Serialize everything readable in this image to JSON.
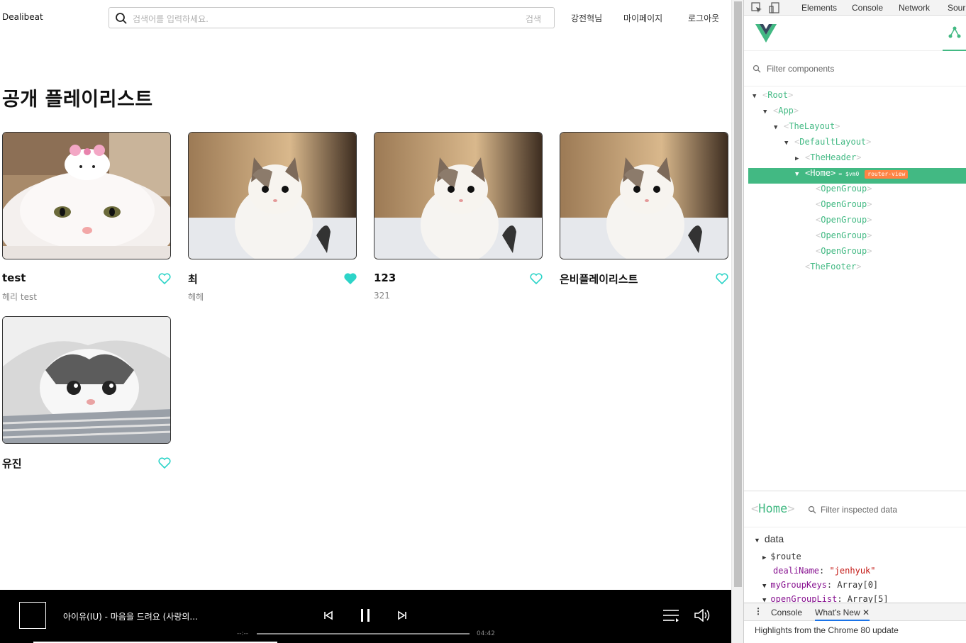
{
  "header": {
    "logo": "Dealibeat",
    "search_placeholder": "검색어를 입력하세요.",
    "search_button": "검색",
    "nav": [
      "강전혁님",
      "마이페이지",
      "로그아웃"
    ]
  },
  "page_title": "공개 플레이리스트",
  "playlists": [
    {
      "title": "test",
      "subtitle": "헤리 test",
      "liked": false,
      "image": "cat-with-hello-kitty-hat"
    },
    {
      "title": "최",
      "subtitle": "헤헤",
      "liked": true,
      "image": "calico-kitten"
    },
    {
      "title": "123",
      "subtitle": "321",
      "liked": false,
      "image": "calico-kitten"
    },
    {
      "title": "은비플레이리스트",
      "subtitle": "",
      "liked": false,
      "image": "calico-kitten"
    },
    {
      "title": "유진",
      "subtitle": "",
      "liked": false,
      "image": "kitten-in-blanket"
    }
  ],
  "player": {
    "track": "아이유(IU) - 마음을 드려요 (사랑의...",
    "elapsed": "--:--",
    "duration": "04:42",
    "state": "playing"
  },
  "devtools": {
    "tabs": [
      "Elements",
      "Console",
      "Network",
      "Sour"
    ],
    "filter_components": "Filter components",
    "tree": [
      {
        "name": "Root",
        "depth": 0,
        "arrow": "down"
      },
      {
        "name": "App",
        "depth": 1,
        "arrow": "down"
      },
      {
        "name": "TheLayout",
        "depth": 2,
        "arrow": "down"
      },
      {
        "name": "DefaultLayout",
        "depth": 3,
        "arrow": "down"
      },
      {
        "name": "TheHeader",
        "depth": 4,
        "arrow": "right"
      },
      {
        "name": "Home",
        "depth": 4,
        "arrow": "down",
        "selected": true,
        "vm": "= $vm0",
        "tag": "router-view"
      },
      {
        "name": "OpenGroup",
        "depth": 5,
        "arrow": ""
      },
      {
        "name": "OpenGroup",
        "depth": 5,
        "arrow": ""
      },
      {
        "name": "OpenGroup",
        "depth": 5,
        "arrow": ""
      },
      {
        "name": "OpenGroup",
        "depth": 5,
        "arrow": ""
      },
      {
        "name": "OpenGroup",
        "depth": 5,
        "arrow": ""
      },
      {
        "name": "TheFooter",
        "depth": 4,
        "arrow": ""
      }
    ],
    "inspected": "Home",
    "filter_inspected": "Filter inspected data",
    "data_section": "data",
    "data_rows": [
      {
        "arrow": "right",
        "key": "$route",
        "value": ""
      },
      {
        "arrow": "",
        "key": "dealiName",
        "value": "\"jenhyuk\""
      },
      {
        "arrow": "down",
        "key": "myGroupKeys",
        "value": "Array[0]"
      },
      {
        "arrow": "down",
        "key": "openGroupList",
        "value": "Array[5]"
      }
    ],
    "console_tabs": [
      "Console",
      "What's New"
    ],
    "highlight": "Highlights from the Chrome 80 update"
  }
}
